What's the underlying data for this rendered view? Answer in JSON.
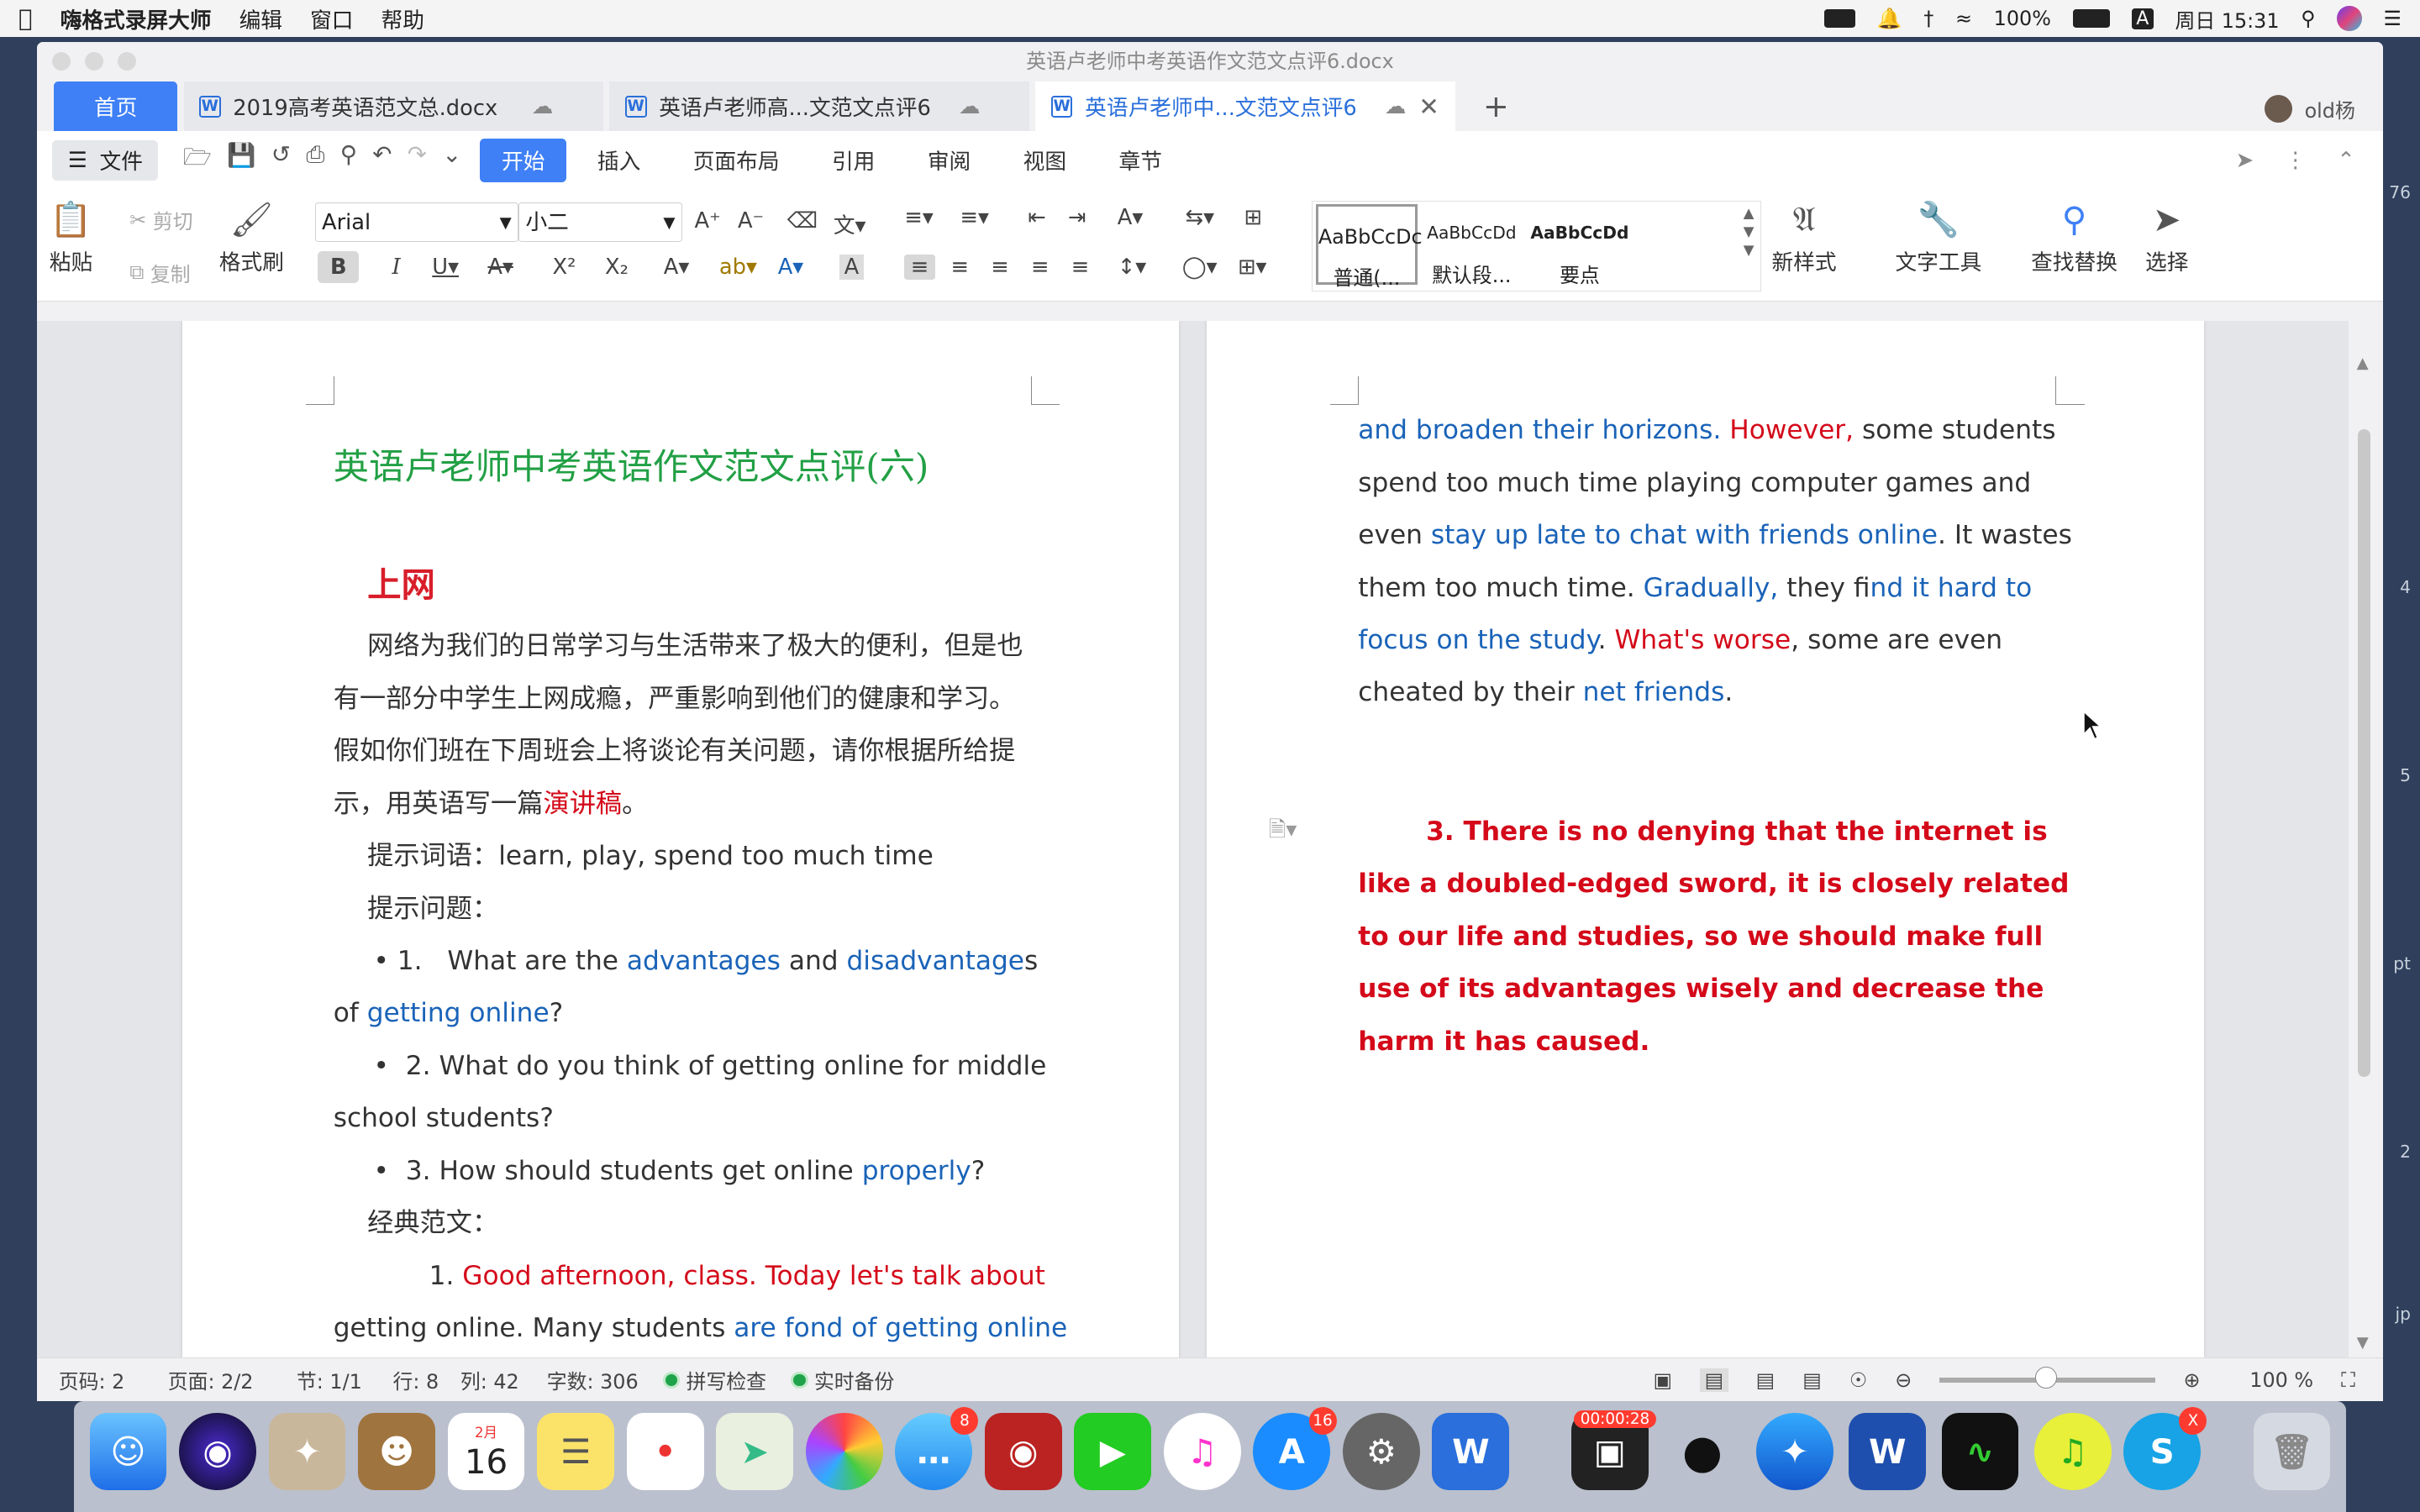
{
  "menubar": {
    "app_name": "嗨格式录屏大师",
    "menus": [
      "编辑",
      "窗口",
      "帮助"
    ],
    "battery": "100%",
    "input_method": "A",
    "clock": "周日 15:31"
  },
  "window": {
    "title": "英语卢老师中考英语作文范文点评6.docx",
    "tabs": {
      "home": "首页",
      "doc1": "2019高考英语范文总.docx",
      "doc2": "英语卢老师高...文范文点评6",
      "doc3": "英语卢老师中...文范文点评6"
    },
    "user": "old杨"
  },
  "menu": {
    "file": "文件",
    "tabs": [
      "开始",
      "插入",
      "页面布局",
      "引用",
      "审阅",
      "视图",
      "章节"
    ]
  },
  "ribbon": {
    "paste": "粘贴",
    "cut": "剪切",
    "copy": "复制",
    "format_painter": "格式刷",
    "font": "Arial",
    "size": "小二",
    "styles": [
      {
        "sample": "AaBbCcDc",
        "name": "普通(..."
      },
      {
        "sample": "AaBbCcDd",
        "name": "默认段..."
      },
      {
        "sample": "AaBbCcDd",
        "name": "要点"
      }
    ],
    "new_style": "新样式",
    "text_tools": "文字工具",
    "find_replace": "查找替换",
    "select": "选择"
  },
  "doc_left": {
    "title": "英语卢老师中考英语作文范文点评(六)",
    "subtitle": "上网",
    "p1_l1": "网络为我们的日常学习与生活带来了极大的便利，但是也",
    "p1_l2": "有一部分中学生上网成瘾，严重影响到他们的健康和学习。",
    "p1_l3": "假如你们班在下周班会上将谈论有关问题，请你根据所给提",
    "p1_l4a": "示，用英语写一篇",
    "p1_l4b": "演讲稿",
    "p1_l4c": "。",
    "hint_words": "提示词语：learn, play, spend too much time",
    "hint_q": "提示问题：",
    "q1a": "• 1.   What are the ",
    "q1b": "advantages",
    "q1c": " and ",
    "q1d": "disadvantage",
    "q1e": "s",
    "q1f": "of ",
    "q1g": "getting online",
    "q1h": "?",
    "q2a": "•  2. What do you think of getting online for middle",
    "q2b": "school students?",
    "q3a": "•  3. How should students get online ",
    "q3b": "properly",
    "q3c": "?",
    "classic": "经典范文：",
    "e1a": "1. ",
    "e1b": "Good afternoon, class. Today let's talk about",
    "e2a": "getting online. Many students ",
    "e2b": "are fond of getting online"
  },
  "doc_right": {
    "l1a": "and broaden their horizons.",
    "l1b": " However,",
    "l1c": " some students",
    "l2": "spend too much time playing computer games and",
    "l3a": "even ",
    "l3b": "stay up late to chat with friends online",
    "l3c": ". It wastes",
    "l4a": "them too much time. ",
    "l4b": "Gradually,",
    "l4c": " they f",
    "l4d": "ind it hard to",
    "l5a": "focus on the study",
    "l5b": ". ",
    "l5c": "What's worse",
    "l5d": ", some are even",
    "l6a": "cheated by their ",
    "l6b": "net friends",
    "l6c": ".",
    "p3_1": "3. There is no denying that the internet is",
    "p3_2": "like a doubled-edged sword, it is closely related",
    "p3_3": "to our life and studies, so we should make full",
    "p3_4": "use of its advantages wisely and decrease the",
    "p3_5": "harm it has caused."
  },
  "status": {
    "page_code": "页码: 2",
    "pages": "页面: 2/2",
    "section": "节: 1/1",
    "row": "行: 8",
    "col": "列: 42",
    "words": "字数: 306",
    "spell": "拼写检查",
    "backup": "实时备份",
    "zoom": "100 %"
  },
  "dock": {
    "calendar_month": "2月",
    "calendar_day": "16",
    "messages_badge": "8",
    "appstore_badge": "16",
    "rec_time": "00:00:28",
    "skype_badge": "X"
  }
}
